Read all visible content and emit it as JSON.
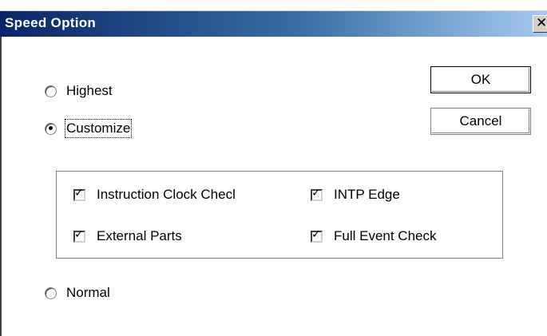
{
  "window": {
    "title": "Speed Option",
    "close_glyph": "✕"
  },
  "speed_modes": [
    {
      "label": "Highest",
      "selected": false
    },
    {
      "label": "Customize",
      "selected": true
    },
    {
      "label": "Normal",
      "selected": false
    }
  ],
  "buttons": {
    "ok_label": "OK",
    "cancel_label": "Cancel"
  },
  "custom_options": [
    {
      "label": "Instruction Clock Checl",
      "checked": true
    },
    {
      "label": "INTP Edge",
      "checked": true
    },
    {
      "label": "External Parts",
      "checked": true
    },
    {
      "label": "Full Event Check",
      "checked": true
    }
  ],
  "check_glyph": "✓",
  "colors": {
    "title_gradient_start": "#0a246a",
    "title_gradient_end": "#a6caf0",
    "button_face": "#d4d0c8"
  }
}
